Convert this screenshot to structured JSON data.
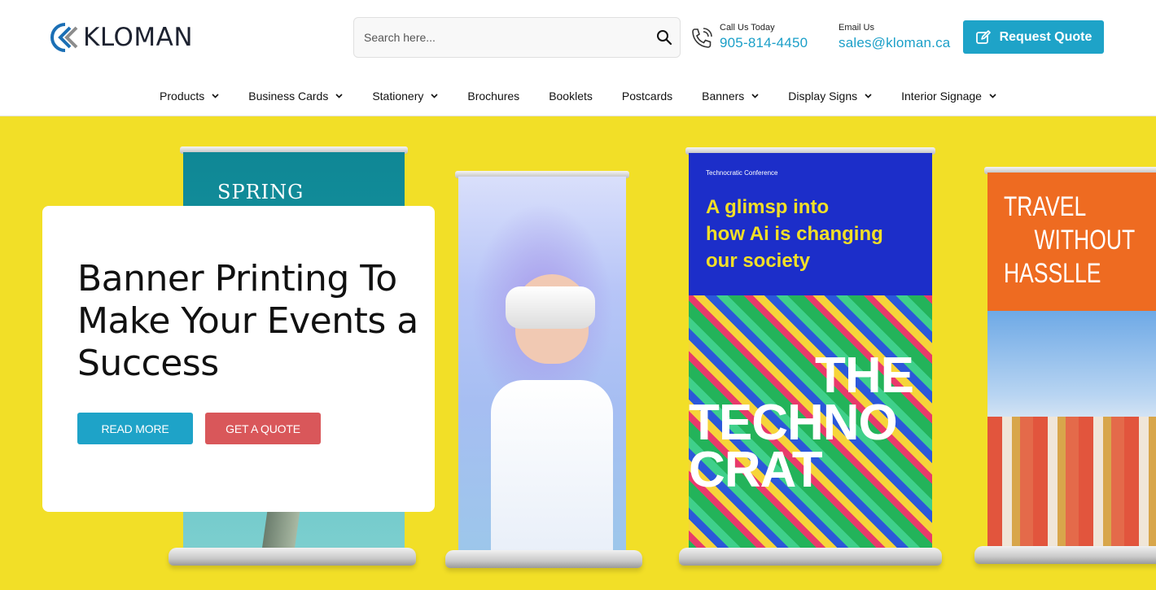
{
  "brand": {
    "name": "KLOMAN"
  },
  "search": {
    "placeholder": "Search here..."
  },
  "contact": {
    "phone_label": "Call Us Today",
    "phone": "905-814-4450",
    "email_label": "Email Us",
    "email": "sales@kloman.ca"
  },
  "header": {
    "quote_button": "Request Quote"
  },
  "nav": [
    {
      "label": "Products",
      "dropdown": true
    },
    {
      "label": "Business Cards",
      "dropdown": true
    },
    {
      "label": "Stationery",
      "dropdown": true
    },
    {
      "label": "Brochures",
      "dropdown": false
    },
    {
      "label": "Booklets",
      "dropdown": false
    },
    {
      "label": "Postcards",
      "dropdown": false
    },
    {
      "label": "Banners",
      "dropdown": true
    },
    {
      "label": "Display Signs",
      "dropdown": true
    },
    {
      "label": "Interior Signage",
      "dropdown": true
    }
  ],
  "hero": {
    "title": "Banner Printing To Make Your Events a Success",
    "read_more": "READ MORE",
    "get_quote": "GET A QUOTE",
    "banners": {
      "spring": "SPRING",
      "tech_event": "Technocratic Conference",
      "tech_headline_1": "A glimsp into",
      "tech_headline_2": "how Ai is changing",
      "tech_headline_3": "our society",
      "tech_big_1": "THE",
      "tech_big_2": "TECHNO",
      "tech_big_3": "CRAT",
      "travel_1": "TRAVEL",
      "travel_2": "WITHOUT",
      "travel_3": "HASSLLE"
    }
  },
  "colors": {
    "accent": "#1ea3c8",
    "secondary": "#d9575a",
    "hero_bg": "#f2df27"
  }
}
